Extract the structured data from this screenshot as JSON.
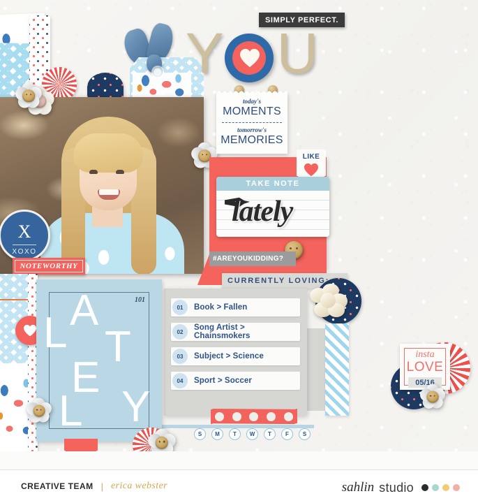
{
  "page": {
    "title": "YOU",
    "background_color": "#f4f3f0"
  },
  "title_block": {
    "letters": [
      "Y",
      "O",
      "U"
    ],
    "badge_label": "SIMPLY PERFECT.",
    "badge_bg": "#3b3b3b",
    "target_outer_color": "#2f6aa8",
    "target_inner_color": "#f3625c",
    "heart_icon": "heart-icon",
    "letter_color": "#cdbf9e"
  },
  "photo": {
    "alt": "smiling blonde girl outdoors",
    "caption_badge": {
      "letter": "X",
      "sub": "XOXO",
      "bg": "#35659c"
    },
    "label": "NOTEWORTHY",
    "label_bg": "#f3625c"
  },
  "moments_card": {
    "line1_small": "today's",
    "line1_big": "MOMENTS",
    "line2_small": "tomorrow's",
    "line2_big": "MEMORIES",
    "text_color": "#2e4f7d"
  },
  "like_tag": {
    "label": "LIKE",
    "icon": "heart-icon",
    "heart_color": "#f3625c"
  },
  "lately_card": {
    "header": "TAKE NOTE",
    "header_bg": "#a9cfdd",
    "script_word": "lately",
    "pen_icon": "pen-nib-icon"
  },
  "hashtag_strip": {
    "text": "#AREYOUKIDDING?",
    "bg": "#9b9b9b"
  },
  "loving_strip": {
    "text": "CURRENTLY LOVING:",
    "bg": "#d9d9d6",
    "text_color": "#2e4f7d"
  },
  "favorites_list": {
    "items": [
      {
        "number": "01",
        "text": "Book > Fallen"
      },
      {
        "number": "02",
        "text": "Song Artist > Chainsmokers"
      },
      {
        "number": "03",
        "text": "Subject > Science"
      },
      {
        "number": "04",
        "text": "Sport > Soccer"
      }
    ],
    "number_bg": "#cfe2ef",
    "text_color": "#2e5289"
  },
  "days_strip": {
    "days": [
      "S",
      "M",
      "T",
      "W",
      "T",
      "F",
      "S"
    ],
    "border_color": "#8fc6e0",
    "text_color": "#2e5289"
  },
  "washi_tape": {
    "color": "#f1635c",
    "hole_count": 5
  },
  "lately_block": {
    "letters": [
      "L",
      "A",
      "T",
      "E",
      "L",
      "Y"
    ],
    "corner_number": "101",
    "bg": "#b9d7e5"
  },
  "insta_stamp": {
    "word_small": "insta",
    "word_big": "LOVE",
    "date": "05/16",
    "accent": "#f3706a",
    "date_text_color": "#2e5289"
  },
  "footer": {
    "credit_label": "CREATIVE TEAM",
    "separator": "|",
    "designer": "erica webster",
    "brand_script": "sahlin",
    "brand_plain": "studio",
    "brand_dots": [
      "#2b2b2b",
      "#a8d8d0",
      "#f0cd72",
      "#efb0a5"
    ]
  }
}
